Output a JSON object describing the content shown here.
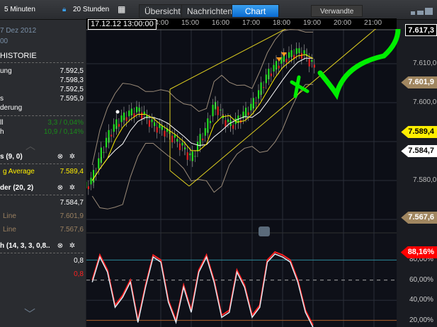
{
  "toolbar": {
    "interval": "5 Minuten",
    "range": "20 Stunden",
    "tabs": [
      "Übersicht",
      "Nachrichten",
      "Chart"
    ],
    "active_tab": "Chart",
    "related": "Verwandte"
  },
  "crosshair_time": "17.12.12 13:00:00",
  "left_panel": {
    "date": "7 Dez 2012",
    "time": "00",
    "section": "HISTORIE",
    "rows": [
      {
        "label": "ung",
        "value": "7.592,5"
      },
      {
        "label": "",
        "value": "7.598,3"
      },
      {
        "label": "",
        "value": "7.592,5"
      },
      {
        "label": "s",
        "value": "7.595,9"
      },
      {
        "label": "derung",
        "value": ""
      }
    ],
    "changes": [
      {
        "label": "ll",
        "value": "3,3 / 0,04%"
      },
      {
        "label": "h",
        "value": "10,9 / 0,14%"
      }
    ],
    "indicators": [
      {
        "title": "s (9, 0)",
        "lines": [
          {
            "label": "g Average",
            "value": "7.589,4",
            "color": "#ffee00"
          }
        ]
      },
      {
        "title": "der (20, 2)",
        "lines": [
          {
            "label": "",
            "value": "7.584,7",
            "color": "#ffffff"
          },
          {
            "label": "Line",
            "value": "7.601,9",
            "color": "#9a8060"
          },
          {
            "label": "Line",
            "value": "7.567,6",
            "color": "#9a8060"
          }
        ]
      },
      {
        "title": "h (14, 3, 3, 0,8..",
        "lines": [
          {
            "label": "",
            "value": "0,8",
            "color": "#ffffff"
          },
          {
            "label": "",
            "value": "0,8",
            "color": "#ff2020"
          }
        ]
      }
    ]
  },
  "chart_data": [
    {
      "type": "candlestick",
      "x_ticks": [
        "14:00",
        "15:00",
        "16:00",
        "17:00",
        "18:00",
        "19:00",
        "20:00",
        "21:00"
      ],
      "y_ticks": [
        "7.610,0",
        "7.600,0",
        "7.580,0"
      ],
      "ylim": [
        7565,
        7620
      ],
      "times": [
        "11:45",
        "12:00",
        "12:15",
        "12:30",
        "12:45",
        "13:00",
        "13:15",
        "13:30",
        "13:45",
        "14:00",
        "14:15",
        "14:30",
        "14:45",
        "15:00",
        "15:15",
        "15:30",
        "15:45",
        "16:00",
        "16:15",
        "16:30",
        "16:45",
        "17:00",
        "17:15",
        "17:30",
        "17:45",
        "18:00",
        "18:15",
        "18:30",
        "18:45",
        "19:00"
      ],
      "close": [
        7580,
        7586,
        7591,
        7594,
        7596,
        7597,
        7598,
        7596,
        7594,
        7593,
        7592,
        7590,
        7588,
        7585,
        7590,
        7593,
        7600,
        7596,
        7594,
        7595,
        7597,
        7599,
        7603,
        7607,
        7609,
        7611,
        7612,
        7613,
        7612,
        7609
      ],
      "price_labels": [
        {
          "value": "7.617,3",
          "color": "#000000",
          "text_color": "#ffffff"
        },
        {
          "value": "7.601,9",
          "color": "#a08660",
          "text_color": "#ffffff"
        },
        {
          "value": "7.589,4",
          "color": "#ffee00",
          "text_color": "#000000"
        },
        {
          "value": "7.584,7",
          "color": "#ffffff",
          "text_color": "#000000"
        },
        {
          "value": "7.567,6",
          "color": "#a08660",
          "text_color": "#ffffff"
        }
      ],
      "colors": {
        "up": "#20e020",
        "down": "#e02020",
        "ma": "#ffee00",
        "bb_mid": "#ffffff",
        "bb_band": "#9a8a78",
        "channel": "#e0d020",
        "annotation": "#00ee00"
      }
    },
    {
      "type": "line",
      "name": "",
      "y_ticks": [
        "80,00%",
        "60,00%",
        "40,00%",
        "20,00%"
      ],
      "ylim": [
        0,
        100
      ],
      "current_label": "88,16%",
      "k": [
        60,
        85,
        70,
        35,
        45,
        60,
        20,
        55,
        85,
        80,
        40,
        20,
        55,
        30,
        70,
        85,
        60,
        25,
        30,
        70,
        55,
        25,
        35,
        80,
        88,
        85,
        80,
        60,
        30,
        15
      ]
    }
  ]
}
